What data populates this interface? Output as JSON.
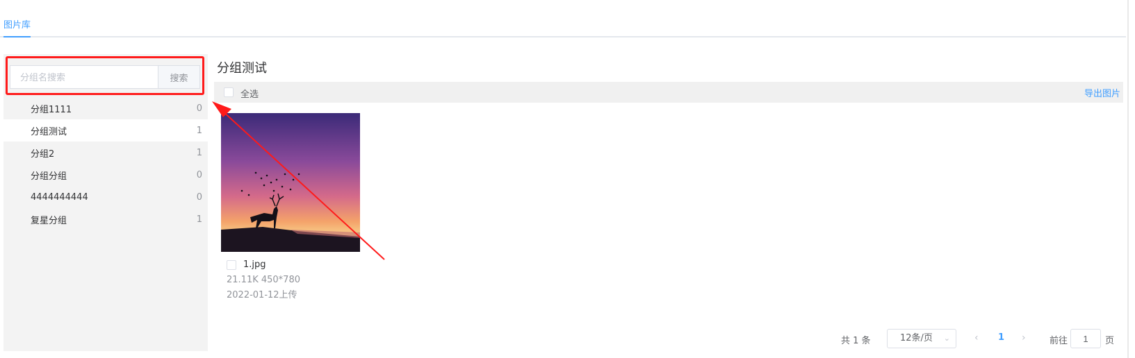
{
  "tabs": {
    "active": "图片库"
  },
  "search": {
    "placeholder": "分组名搜索",
    "button_label": "搜索"
  },
  "groups": [
    {
      "name": "分组1111",
      "count": "0"
    },
    {
      "name": "分组测试",
      "count": "1",
      "active": true
    },
    {
      "name": "分组2",
      "count": "1"
    },
    {
      "name": "分组分组",
      "count": "0"
    },
    {
      "name": "4444444444",
      "count": "0"
    },
    {
      "name": "复星分组",
      "count": "1"
    }
  ],
  "main": {
    "title": "分组测试",
    "select_all_label": "全选",
    "export_label": "导出图片"
  },
  "images": [
    {
      "name": "1.jpg",
      "meta": "21.11K   450*780",
      "date": "2022-01-12上传"
    }
  ],
  "pagination": {
    "total": "共 1 条",
    "page_size": "12条/页",
    "current_page": "1",
    "goto_label": "前往",
    "goto_value": "1",
    "page_suffix": "页"
  },
  "colors": {
    "accent": "#409eff",
    "annotation_red": "#ff1a1a",
    "sidebar_bg": "#f3f3f3"
  }
}
